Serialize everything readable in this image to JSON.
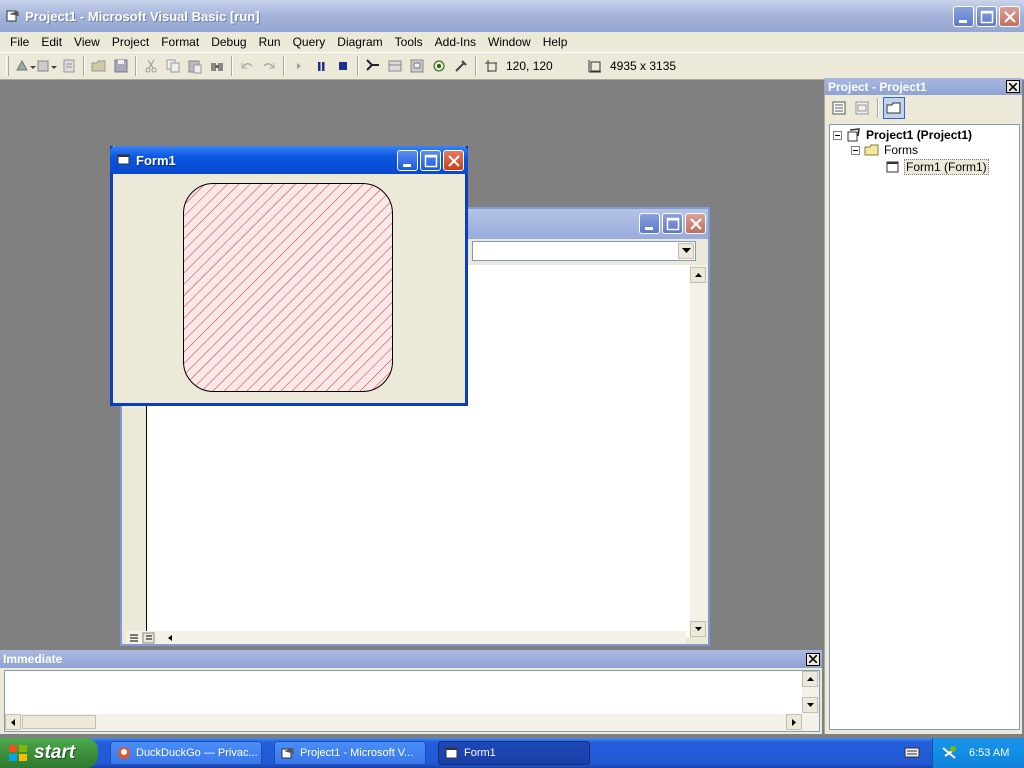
{
  "window": {
    "title": "Project1 - Microsoft Visual Basic [run]"
  },
  "menu": [
    "File",
    "Edit",
    "View",
    "Project",
    "Format",
    "Debug",
    "Run",
    "Query",
    "Diagram",
    "Tools",
    "Add-Ins",
    "Window",
    "Help"
  ],
  "toolbar": {
    "position": "120, 120",
    "size": "4935 x 3135"
  },
  "project": {
    "title": "Project - Project1",
    "tree": {
      "root": "Project1 (Project1)",
      "folder": "Forms",
      "item": "Form1 (Form1)"
    }
  },
  "immediate": {
    "title": "Immediate"
  },
  "form1": {
    "title": "Form1",
    "shape_fill_color": "#cc3333",
    "shape_bg_color": "#fce8e6"
  },
  "taskbar": {
    "start": "start",
    "tasks": [
      "DuckDuckGo — Privac...",
      "Project1 - Microsoft V...",
      "Form1"
    ],
    "clock": "6:53 AM"
  }
}
